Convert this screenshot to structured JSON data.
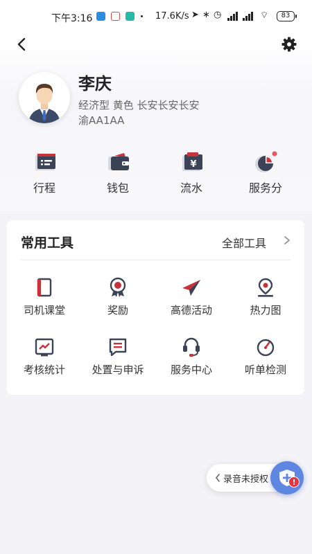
{
  "status_bar": {
    "time": "下午3:16",
    "net_speed": "17.6K/s",
    "battery": "83"
  },
  "profile": {
    "name": "李庆",
    "car_info": "经济型 黄色 长安长安长安",
    "plate": "渝AA1AA"
  },
  "quick_entries": [
    {
      "label": "行程",
      "icon": "itinerary-icon"
    },
    {
      "label": "钱包",
      "icon": "wallet-icon"
    },
    {
      "label": "流水",
      "icon": "ledger-icon"
    },
    {
      "label": "服务分",
      "icon": "service-score-icon"
    }
  ],
  "tools": {
    "title": "常用工具",
    "all_label": "全部工具",
    "items": [
      {
        "label": "司机课堂",
        "icon": "classroom-icon"
      },
      {
        "label": "奖励",
        "icon": "reward-icon"
      },
      {
        "label": "高德活动",
        "icon": "paper-plane-icon"
      },
      {
        "label": "热力图",
        "icon": "heatmap-location-icon"
      },
      {
        "label": "考核统计",
        "icon": "statistics-icon"
      },
      {
        "label": "处置与申诉",
        "icon": "appeal-icon"
      },
      {
        "label": "服务中心",
        "icon": "headset-icon"
      },
      {
        "label": "听单检测",
        "icon": "gauge-icon"
      }
    ]
  },
  "recording": {
    "label": "录音未授权",
    "badge": "!"
  },
  "colors": {
    "accent_red": "#c8323a",
    "icon_dark": "#3d4357",
    "float_blue": "#5f86e0"
  }
}
